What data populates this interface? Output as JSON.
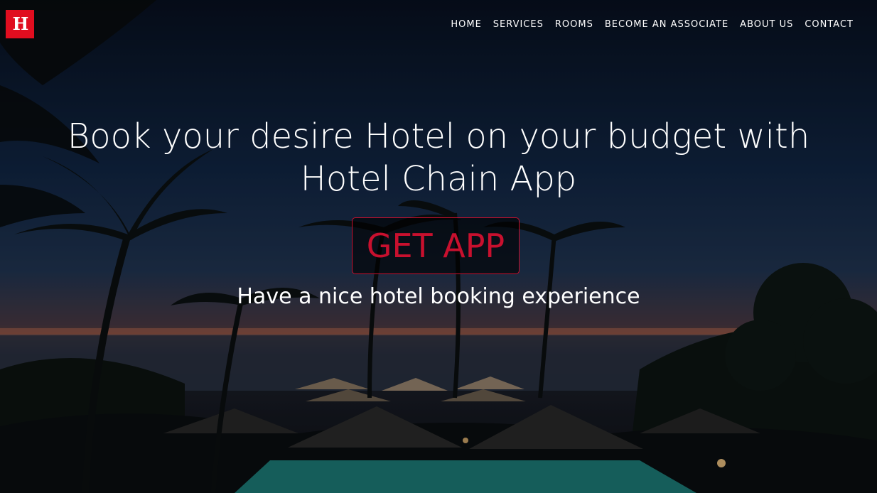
{
  "brand": {
    "logo_icon": "hotel-chain-logo-icon",
    "logo_letter": "H",
    "accent_color": "#e00d1f"
  },
  "nav": {
    "items": [
      {
        "label": "HOME"
      },
      {
        "label": "SERVICES"
      },
      {
        "label": "ROOMS"
      },
      {
        "label": "BECOME AN ASSOCIATE"
      },
      {
        "label": "ABOUT US"
      },
      {
        "label": "CONTACT"
      }
    ]
  },
  "hero": {
    "headline": "Book your desire Hotel on your budget with Hotel Chain App",
    "cta_label": "GET APP",
    "cta_color": "#c8102e",
    "subline": "Have a nice hotel booking experience"
  }
}
